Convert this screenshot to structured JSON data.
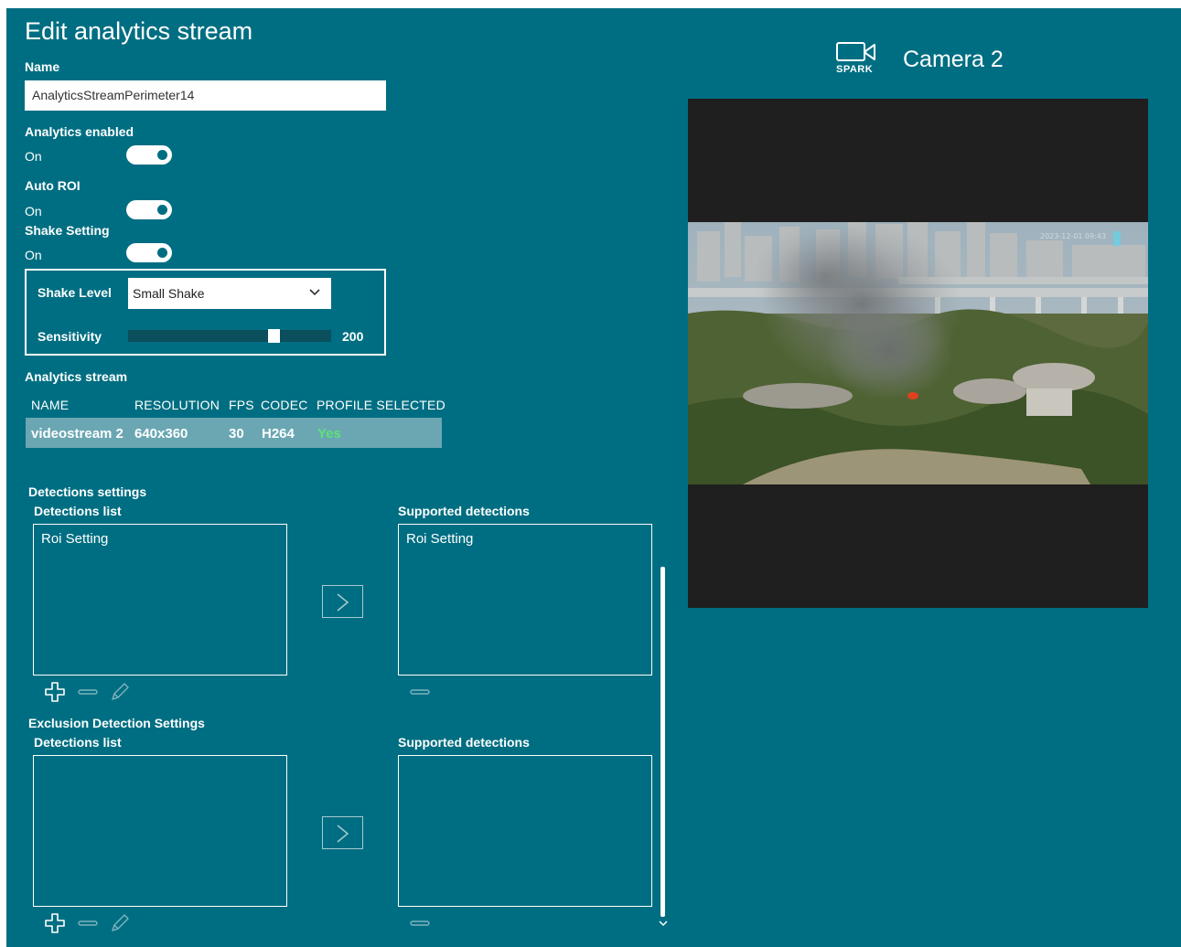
{
  "page": {
    "title": "Edit analytics stream"
  },
  "name_field": {
    "label": "Name",
    "value": "AnalyticsStreamPerimeter14"
  },
  "analytics_enabled": {
    "label": "Analytics enabled",
    "state_label": "On"
  },
  "auto_roi": {
    "label": "Auto ROI",
    "state_label": "On"
  },
  "shake_setting": {
    "label": "Shake Setting",
    "state_label": "On"
  },
  "shake_group": {
    "shake_level_label": "Shake Level",
    "shake_level_value": "Small Shake",
    "sensitivity_label": "Sensitivity",
    "sensitivity_value": "200",
    "sensitivity_fraction": 0.73
  },
  "analytics_stream": {
    "section_label": "Analytics stream",
    "columns": [
      "NAME",
      "RESOLUTION",
      "FPS",
      "CODEC",
      "PROFILE SELECTED"
    ],
    "rows": [
      {
        "name": "videostream 2",
        "resolution": "640x360",
        "fps": "30",
        "codec": "H264",
        "profile_selected": "Yes"
      }
    ]
  },
  "detections": {
    "section_label": "Detections settings",
    "list_label": "Detections list",
    "list_items": [
      "Roi Setting"
    ],
    "supported_label": "Supported detections",
    "supported_items": [
      "Roi Setting"
    ]
  },
  "exclusion": {
    "section_label": "Exclusion Detection Settings",
    "list_label": "Detections list",
    "list_items": [],
    "supported_label": "Supported detections",
    "supported_items": []
  },
  "camera": {
    "brand_label": "SPARK",
    "name": "Camera 2"
  },
  "colors": {
    "background": "#006e82",
    "selected_row": "#6aa7b3",
    "yes_text": "#5fe07a",
    "video_letterbox": "#1f1f1f"
  },
  "icons": [
    "camera-icon",
    "chevron-down-icon",
    "chevron-right-icon",
    "plus-icon",
    "minus-icon",
    "pencil-icon"
  ]
}
